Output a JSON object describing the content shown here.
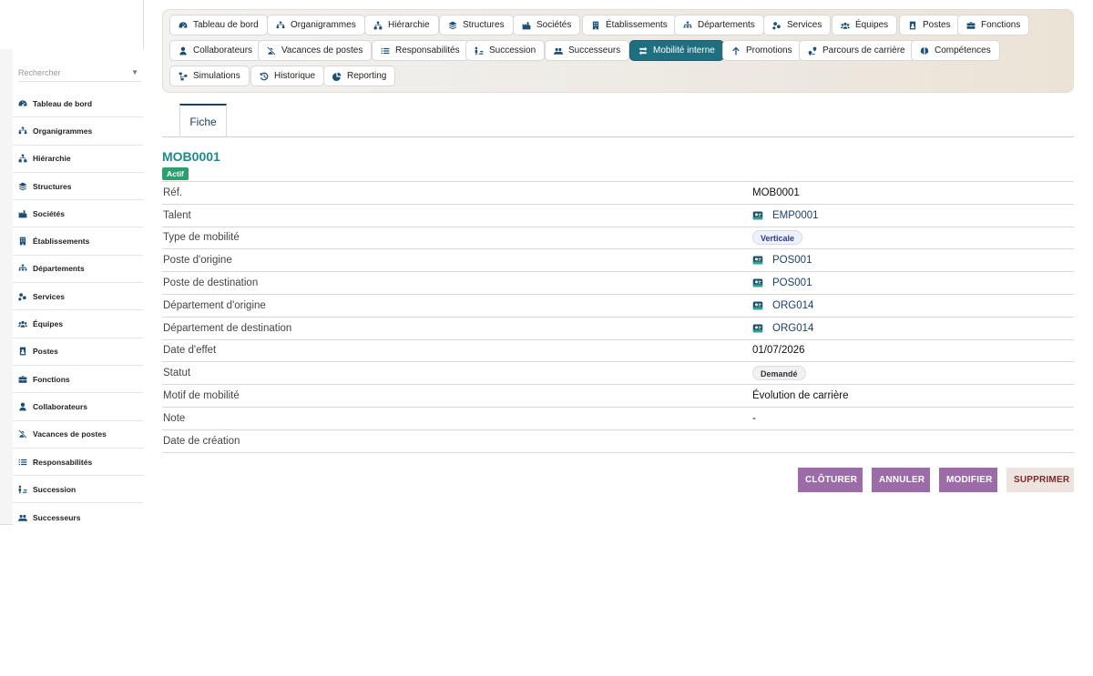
{
  "sidebar": {
    "search_placeholder": "Rechercher",
    "items": [
      {
        "label": "Tableau de bord",
        "icon": "gauge-icon"
      },
      {
        "label": "Organigrammes",
        "icon": "org-chart-icon"
      },
      {
        "label": "Hiérarchie",
        "icon": "hierarchy-icon"
      },
      {
        "label": "Structures",
        "icon": "layers-icon"
      },
      {
        "label": "Sociétés",
        "icon": "industry-icon"
      },
      {
        "label": "Établissements",
        "icon": "building-icon"
      },
      {
        "label": "Départements",
        "icon": "sitemap-icon"
      },
      {
        "label": "Services",
        "icon": "services-icon"
      },
      {
        "label": "Équipes",
        "icon": "team-icon"
      },
      {
        "label": "Postes",
        "icon": "id-badge-icon"
      },
      {
        "label": "Fonctions",
        "icon": "briefcase-icon"
      },
      {
        "label": "Collaborateurs",
        "icon": "user-tie-icon"
      },
      {
        "label": "Vacances de postes",
        "icon": "user-slash-icon"
      },
      {
        "label": "Responsabilités",
        "icon": "list-icon"
      },
      {
        "label": "Succession",
        "icon": "succession-icon"
      },
      {
        "label": "Successeurs",
        "icon": "users-icon"
      }
    ]
  },
  "nav": {
    "pills": [
      {
        "label": "Tableau de bord",
        "icon": "gauge-icon"
      },
      {
        "label": "Organigrammes",
        "icon": "org-chart-icon"
      },
      {
        "label": "Hiérarchie",
        "icon": "hierarchy-icon"
      },
      {
        "label": "Structures",
        "icon": "layers-icon"
      },
      {
        "label": "Sociétés",
        "icon": "industry-icon"
      },
      {
        "label": "Établissements",
        "icon": "building-icon"
      },
      {
        "label": "Départements",
        "icon": "sitemap-icon"
      },
      {
        "label": "Services",
        "icon": "services-icon"
      },
      {
        "label": "Équipes",
        "icon": "team-icon"
      },
      {
        "label": "Postes",
        "icon": "id-badge-icon"
      },
      {
        "label": "Fonctions",
        "icon": "briefcase-icon"
      },
      {
        "label": "Collaborateurs",
        "icon": "user-tie-icon"
      },
      {
        "label": "Vacances de postes",
        "icon": "user-slash-icon"
      },
      {
        "label": "Responsabilités",
        "icon": "list-icon"
      },
      {
        "label": "Succession",
        "icon": "succession-icon"
      },
      {
        "label": "Successeurs",
        "icon": "users-icon"
      },
      {
        "label": "Mobilité interne",
        "icon": "exchange-icon",
        "active": true
      },
      {
        "label": "Promotions",
        "icon": "arrow-up-icon"
      },
      {
        "label": "Parcours de carrière",
        "icon": "route-icon"
      },
      {
        "label": "Compétences",
        "icon": "brain-icon"
      },
      {
        "label": "Simulations",
        "icon": "flow-icon"
      },
      {
        "label": "Historique",
        "icon": "history-icon"
      },
      {
        "label": "Reporting",
        "icon": "pie-chart-icon"
      }
    ]
  },
  "tabs": {
    "fiche": "Fiche"
  },
  "record": {
    "code": "MOB0001",
    "status_badge": "Actif",
    "fields": {
      "ref_label": "Réf.",
      "ref_value": "MOB0001",
      "talent_label": "Talent",
      "talent_value": "EMP0001",
      "type_label": "Type de mobilité",
      "type_value": "Verticale",
      "origin_post_label": "Poste d'origine",
      "origin_post_value": "POS001",
      "dest_post_label": "Poste de destination",
      "dest_post_value": "POS001",
      "origin_dept_label": "Département d'origine",
      "origin_dept_value": "ORG014",
      "dest_dept_label": "Département de destination",
      "dest_dept_value": "ORG014",
      "effect_date_label": "Date d'effet",
      "effect_date_value": "01/07/2026",
      "status_label": "Statut",
      "status_value": "Demandé",
      "reason_label": "Motif de mobilité",
      "reason_value": "Évolution de carrière",
      "note_label": "Note",
      "note_value": "-",
      "created_label": "Date de création",
      "created_value": ""
    }
  },
  "actions": {
    "close": "CLÔTURER",
    "cancel": "ANNULER",
    "edit": "MODIFIER",
    "delete": "SUPPRIMER"
  },
  "colors": {
    "accent": "#1e6f80",
    "title": "#1e8a8a",
    "badge_green": "#2e9e6e",
    "button_purple": "#9c6ca9"
  }
}
